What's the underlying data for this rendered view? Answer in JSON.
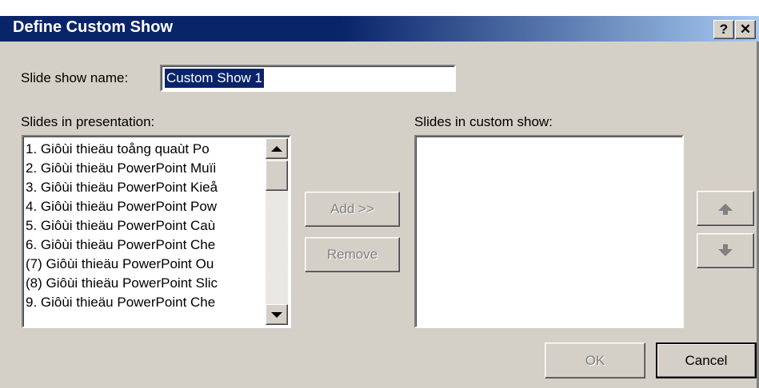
{
  "window": {
    "title": "Define Custom Show",
    "help_label": "?",
    "close_label": "✕"
  },
  "name_field": {
    "label": "Slide show name:",
    "value": "Custom Show 1"
  },
  "left_list": {
    "label": "Slides in presentation:",
    "items": [
      "1. Giôùi thieäu toång quaùt Po",
      "2. Giôùi thieäu PowerPoint Muïi",
      "3. Giôùi thieäu PowerPoint Kieå",
      "4. Giôùi thieäu PowerPoint Pow",
      "5. Giôùi thieäu PowerPoint Caù",
      "6. Giôùi thieäu PowerPoint Che",
      "(7) Giôùi thieäu PowerPoint Ou",
      "(8) Giôùi thieäu PowerPoint Slic",
      "9. Giôùi thieäu PowerPoint Che"
    ]
  },
  "right_list": {
    "label": "Slides in custom show:"
  },
  "buttons": {
    "add": "Add >>",
    "remove": "Remove",
    "ok": "OK",
    "cancel": "Cancel"
  }
}
